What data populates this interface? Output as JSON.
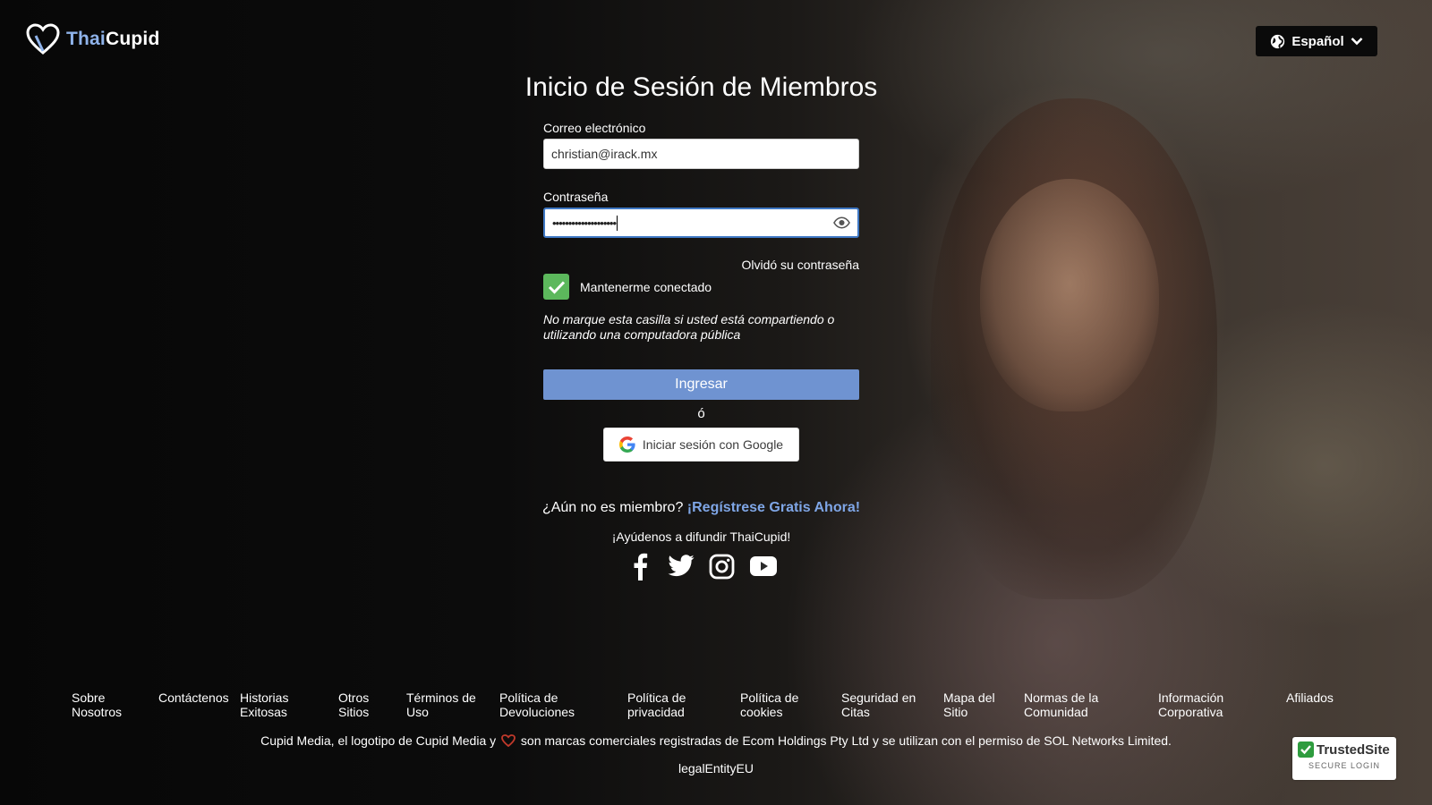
{
  "brand": {
    "name_part1": "Thai",
    "name_part2": "Cupid",
    "accent": "#8fb3ea"
  },
  "language": {
    "label": "Español"
  },
  "form": {
    "title": "Inicio de Sesión de Miembros",
    "email_label": "Correo electrónico",
    "email_value": "christian@irack.mx",
    "password_label": "Contraseña",
    "password_masked": "••••••••••••••••••••",
    "forgot": "Olvidó su contraseña",
    "remember_label": "Mantenerme conectado",
    "remember_checked": true,
    "note": "No marque esta casilla si usted está compartiendo o utilizando una computadora pública",
    "submit": "Ingresar",
    "or": "ó",
    "google": "Iniciar sesión con Google"
  },
  "register": {
    "prompt": "¿Aún no es miembro?",
    "link": "¡Regístrese Gratis Ahora!"
  },
  "spread": "¡Ayúdenos a difundir ThaiCupid!",
  "social": [
    "facebook-icon",
    "twitter-icon",
    "instagram-icon",
    "youtube-icon"
  ],
  "footer": {
    "links": [
      "Sobre Nosotros",
      "Contáctenos",
      "Historias Exitosas",
      "Otros Sitios",
      "Términos de Uso",
      "Política de Devoluciones",
      "Política de privacidad",
      "Política de cookies",
      "Seguridad en Citas",
      "Mapa del Sitio",
      "Normas de la Comunidad",
      "Información Corporativa",
      "Afiliados"
    ],
    "legal_part1": "Cupid Media, el logotipo de Cupid Media y",
    "legal_part2": "son marcas comerciales registradas de Ecom Holdings Pty Ltd y se utilizan con el permiso de SOL Networks Limited.",
    "entity": "legalEntityEU"
  },
  "trusted": {
    "brand": "TrustedSite",
    "sub": "SECURE LOGIN"
  },
  "colors": {
    "submit": "#6f93d1",
    "checkbox": "#5cb85c",
    "link": "#7fa6e6"
  }
}
